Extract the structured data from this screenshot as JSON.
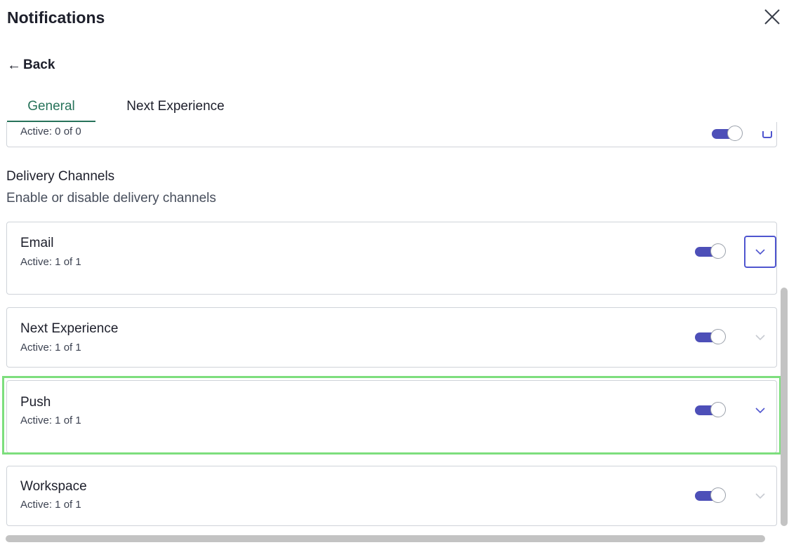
{
  "panel": {
    "title": "Notifications",
    "close_icon": "close-icon",
    "back_label": "Back",
    "back_arrow": "←"
  },
  "tabs": [
    {
      "label": "General",
      "active": true
    },
    {
      "label": "Next Experience",
      "active": false
    }
  ],
  "partial_card": {
    "status": "Active: 0 of 0",
    "enabled": true
  },
  "delivery_section": {
    "title": "Delivery Channels",
    "subtitle": "Enable or disable delivery channels"
  },
  "channels": [
    {
      "name": "Email",
      "status": "Active: 1 of 1",
      "enabled": true,
      "expand_state": "focused"
    },
    {
      "name": "Next Experience",
      "status": "Active: 1 of 1",
      "enabled": true,
      "expand_state": "disabled"
    },
    {
      "name": "Push",
      "status": "Active: 1 of 1",
      "enabled": true,
      "expand_state": "enabled"
    },
    {
      "name": "Workspace",
      "status": "Active: 1 of 1",
      "enabled": true,
      "expand_state": "disabled"
    }
  ],
  "colors": {
    "accent": "#4d4fb8",
    "tab_active": "#27735a",
    "highlight": "#7dde7d",
    "chevron_enabled": "#4f55cf",
    "chevron_disabled": "#c7cad1"
  }
}
